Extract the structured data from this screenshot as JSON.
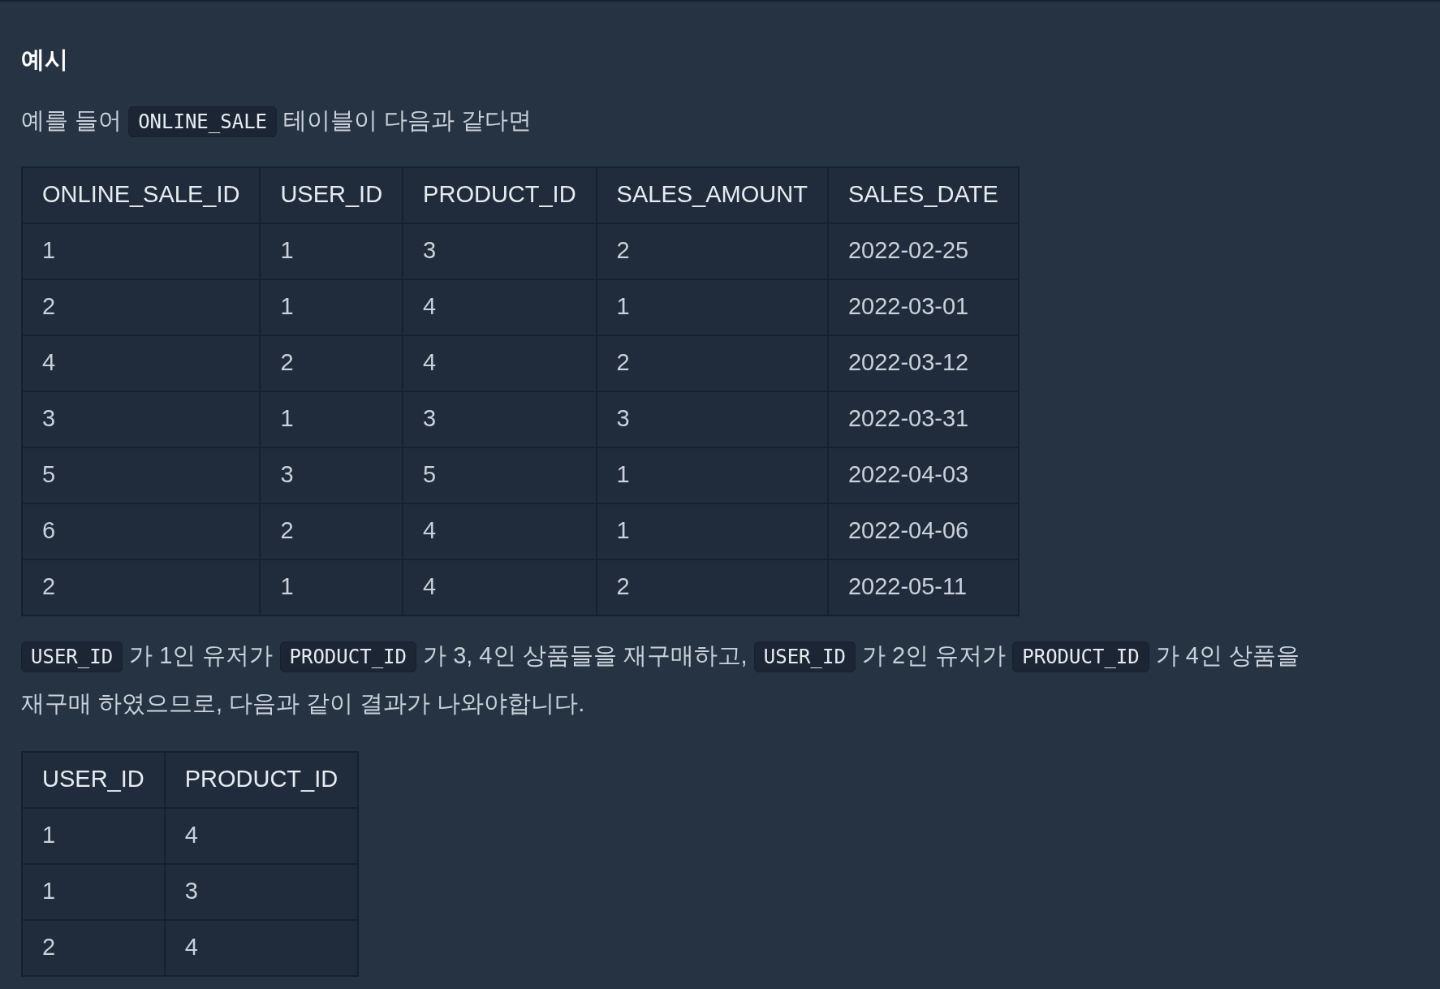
{
  "heading": "예시",
  "intro": [
    {
      "kind": "text",
      "text": "예를 들어 "
    },
    {
      "kind": "code",
      "text": "ONLINE_SALE"
    },
    {
      "kind": "text",
      "text": " 테이블이 다음과 같다면"
    }
  ],
  "sales_table": {
    "columns": [
      "ONLINE_SALE_ID",
      "USER_ID",
      "PRODUCT_ID",
      "SALES_AMOUNT",
      "SALES_DATE"
    ],
    "rows": [
      [
        "1",
        "1",
        "3",
        "2",
        "2022-02-25"
      ],
      [
        "2",
        "1",
        "4",
        "1",
        "2022-03-01"
      ],
      [
        "4",
        "2",
        "4",
        "2",
        "2022-03-12"
      ],
      [
        "3",
        "1",
        "3",
        "3",
        "2022-03-31"
      ],
      [
        "5",
        "3",
        "5",
        "1",
        "2022-04-03"
      ],
      [
        "6",
        "2",
        "4",
        "1",
        "2022-04-06"
      ],
      [
        "2",
        "1",
        "4",
        "2",
        "2022-05-11"
      ]
    ]
  },
  "explanation": [
    {
      "kind": "code",
      "text": "USER_ID"
    },
    {
      "kind": "text",
      "text": " 가 1인 유저가 "
    },
    {
      "kind": "code",
      "text": "PRODUCT_ID"
    },
    {
      "kind": "text",
      "text": " 가 3, 4인 상품들을 재구매하고, "
    },
    {
      "kind": "code",
      "text": "USER_ID"
    },
    {
      "kind": "text",
      "text": " 가 2인 유저가 "
    },
    {
      "kind": "code",
      "text": "PRODUCT_ID"
    },
    {
      "kind": "text",
      "text": " 가 4인 상품을"
    },
    {
      "kind": "line",
      "text": "재구매 하였으므로, 다음과 같이 결과가 나와야합니다."
    }
  ],
  "result_table": {
    "columns": [
      "USER_ID",
      "PRODUCT_ID"
    ],
    "rows": [
      [
        "1",
        "4"
      ],
      [
        "1",
        "3"
      ],
      [
        "2",
        "4"
      ]
    ]
  }
}
